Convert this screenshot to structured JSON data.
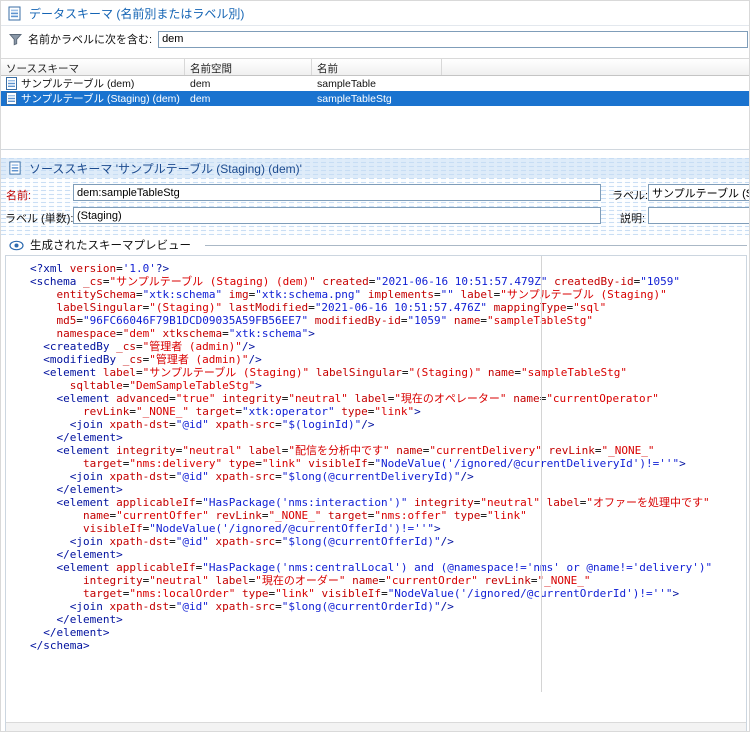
{
  "header": {
    "icon": "schema-icon",
    "title": "データスキーマ (名前別またはラベル別)"
  },
  "filter": {
    "icon": "funnel-icon",
    "label": "名前かラベルに次を含む:",
    "value": "dem"
  },
  "table": {
    "columns": [
      {
        "label": "ソーススキーマ"
      },
      {
        "label": "名前空間"
      },
      {
        "label": "名前"
      }
    ],
    "rows": [
      {
        "icon": "schema-icon",
        "source": "サンプルテーブル (dem)",
        "namespace": "dem",
        "name": "sampleTable",
        "selected": false
      },
      {
        "icon": "schema-icon",
        "source": "サンプルテーブル (Staging) (dem)",
        "namespace": "dem",
        "name": "sampleTableStg",
        "selected": true
      }
    ]
  },
  "detail": {
    "icon": "schema-icon",
    "title": "ソーススキーマ 'サンプルテーブル (Staging) (dem)'",
    "fields": {
      "name": {
        "label": "名前:",
        "value": "dem:sampleTableStg",
        "required": true
      },
      "label": {
        "label": "ラベル:",
        "value": "サンプルテーブル (Staging)"
      },
      "label_singular": {
        "label": "ラベル (単数):",
        "value": "(Staging)"
      },
      "description": {
        "label": "説明:",
        "value": ""
      }
    }
  },
  "preview": {
    "icon": "eye-icon",
    "title": "生成されたスキーマプレビュー",
    "xml_lines": [
      "<?xml version='1.0'?>",
      "<schema _cs=\"サンプルテーブル (Staging) (dem)\" created=\"2021-06-16 10:51:57.479Z\" createdBy-id=\"1059\"",
      "    entitySchema=\"xtk:schema\" img=\"xtk:schema.png\" implements=\"\" label=\"サンプルテーブル (Staging)\"",
      "    labelSingular=\"(Staging)\" lastModified=\"2021-06-16 10:51:57.476Z\" mappingType=\"sql\"",
      "    md5=\"96FC66046F79B1DCD09035A59FB56EE7\" modifiedBy-id=\"1059\" name=\"sampleTableStg\"",
      "    namespace=\"dem\" xtkschema=\"xtk:schema\">",
      "  <createdBy _cs=\"管理者 (admin)\"/>",
      "  <modifiedBy _cs=\"管理者 (admin)\"/>",
      "  <element label=\"サンプルテーブル (Staging)\" labelSingular=\"(Staging)\" name=\"sampleTableStg\"",
      "      sqltable=\"DemSampleTableStg\">",
      "    <element advanced=\"true\" integrity=\"neutral\" label=\"現在のオペレーター\" name=\"currentOperator\"",
      "        revLink=\"_NONE_\" target=\"xtk:operator\" type=\"link\">",
      "      <join xpath-dst=\"@id\" xpath-src=\"$(loginId)\"/>",
      "    </element>",
      "    <element integrity=\"neutral\" label=\"配信を分析中です\" name=\"currentDelivery\" revLink=\"_NONE_\"",
      "        target=\"nms:delivery\" type=\"link\" visibleIf=\"NodeValue('/ignored/@currentDeliveryId')!=''\">",
      "      <join xpath-dst=\"@id\" xpath-src=\"$long(@currentDeliveryId)\"/>",
      "    </element>",
      "    <element applicableIf=\"HasPackage('nms:interaction')\" integrity=\"neutral\" label=\"オファーを処理中です\"",
      "        name=\"currentOffer\" revLink=\"_NONE_\" target=\"nms:offer\" type=\"link\"",
      "        visibleIf=\"NodeValue('/ignored/@currentOfferId')!=''\">",
      "      <join xpath-dst=\"@id\" xpath-src=\"$long(@currentOfferId)\"/>",
      "    </element>",
      "    <element applicableIf=\"HasPackage('nms:centralLocal') and (@namespace!='nms' or @name!='delivery')\"",
      "        integrity=\"neutral\" label=\"現在のオーダー\" name=\"currentOrder\" revLink=\"_NONE_\"",
      "        target=\"nms:localOrder\" type=\"link\" visibleIf=\"NodeValue('/ignored/@currentOrderId')!=''\">",
      "      <join xpath-dst=\"@id\" xpath-src=\"$long(@currentOrderId)\"/>",
      "    </element>",
      "  </element>",
      "</schema>"
    ]
  },
  "colors": {
    "selection_bg": "#1a73cf",
    "selection_text": "#ffffff",
    "header_title": "#1464b4",
    "section_title": "#1c4b8f",
    "required_label": "#c00000",
    "section_bg": "#d9e8f8",
    "xml_tag": "#00119e",
    "xml_attr_name": "#c40000",
    "xml_value_red": "#d80000",
    "xml_value_blue": "#0f1ed4"
  }
}
